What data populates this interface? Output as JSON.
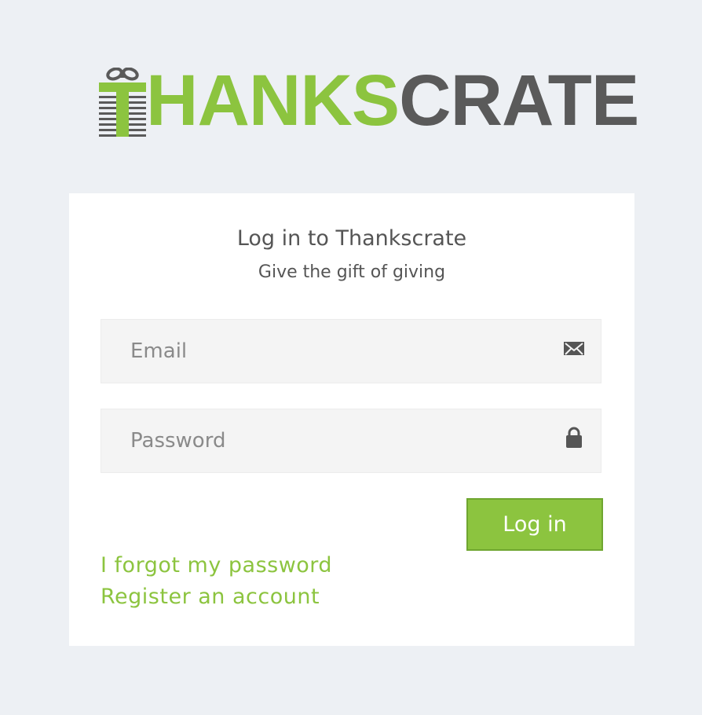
{
  "brand": {
    "logo_part1": "HANKS",
    "logo_part2": "CRATE",
    "logo_initial": "T",
    "green": "#8cc43f",
    "gray": "#5a5a5a"
  },
  "login": {
    "title": "Log in to Thankscrate",
    "subtitle": "Give the gift of giving",
    "email_placeholder": "Email",
    "email_value": "",
    "password_placeholder": "Password",
    "password_value": "",
    "email_icon": "envelope-icon",
    "password_icon": "lock-icon",
    "submit_label": "Log in",
    "forgot_link": "I forgot my password",
    "register_link": "Register an account"
  },
  "colors": {
    "background": "#edf0f4",
    "card": "#ffffff",
    "accent": "#8cc43f",
    "text": "#555555"
  }
}
